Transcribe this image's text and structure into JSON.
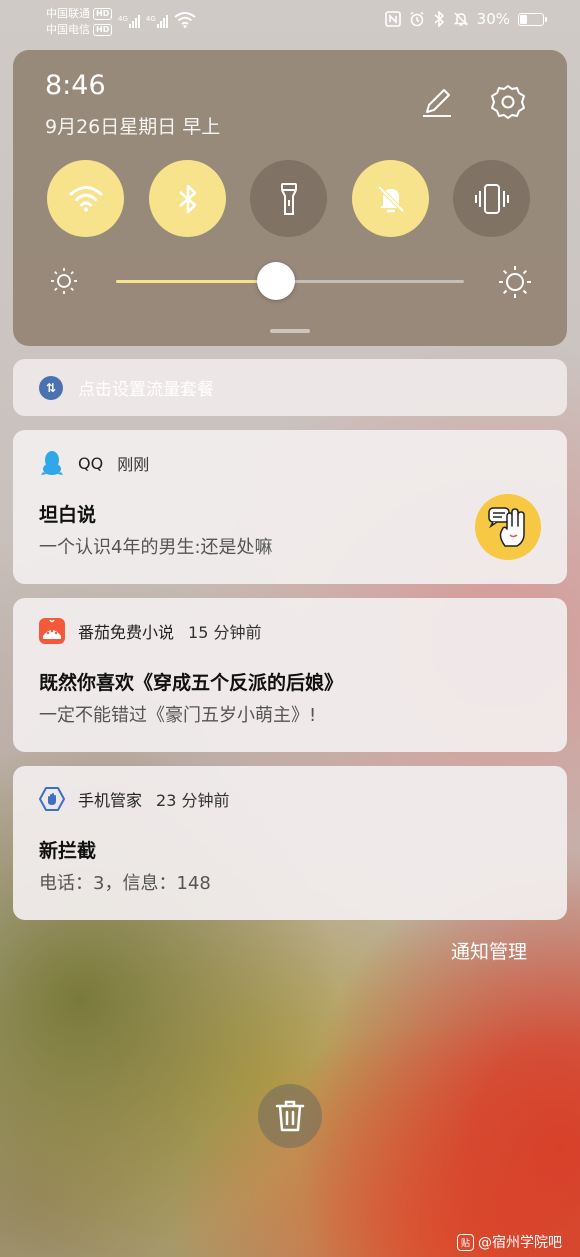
{
  "status_bar": {
    "carrier1": "中国联通",
    "carrier2": "中国电信",
    "hd_badge": "HD",
    "network_type": "4G",
    "battery_percent": "30%",
    "battery_level": 0.3,
    "icons": [
      "nfc-icon",
      "alarm-icon",
      "bluetooth-icon",
      "mute-icon",
      "battery-icon"
    ]
  },
  "quick_settings": {
    "time": "8:46",
    "date": "9月26日星期日 早上",
    "toggles": [
      {
        "name": "wifi",
        "on": true
      },
      {
        "name": "bluetooth",
        "on": true
      },
      {
        "name": "flashlight",
        "on": false
      },
      {
        "name": "mute",
        "on": true
      },
      {
        "name": "vibrate",
        "on": false
      }
    ],
    "brightness_level": 0.46,
    "accent_color": "#f6e38c"
  },
  "data_plan": {
    "label": "点击设置流量套餐"
  },
  "notifications": [
    {
      "app": "QQ",
      "time": "刚刚",
      "title": "坦白说",
      "text": "一个认识4年的男生:还是处嘛"
    },
    {
      "app": "番茄免费小说",
      "time": "15 分钟前",
      "title": "既然你喜欢《穿成五个反派的后娘》",
      "text": "一定不能错过《豪门五岁小萌主》!"
    },
    {
      "app": "手机管家",
      "time": "23 分钟前",
      "title": "新拦截",
      "text": "电话：3，信息：148"
    }
  ],
  "notification_manage": "通知管理",
  "watermark": "@宿州学院吧",
  "watermark_badge": "贴"
}
